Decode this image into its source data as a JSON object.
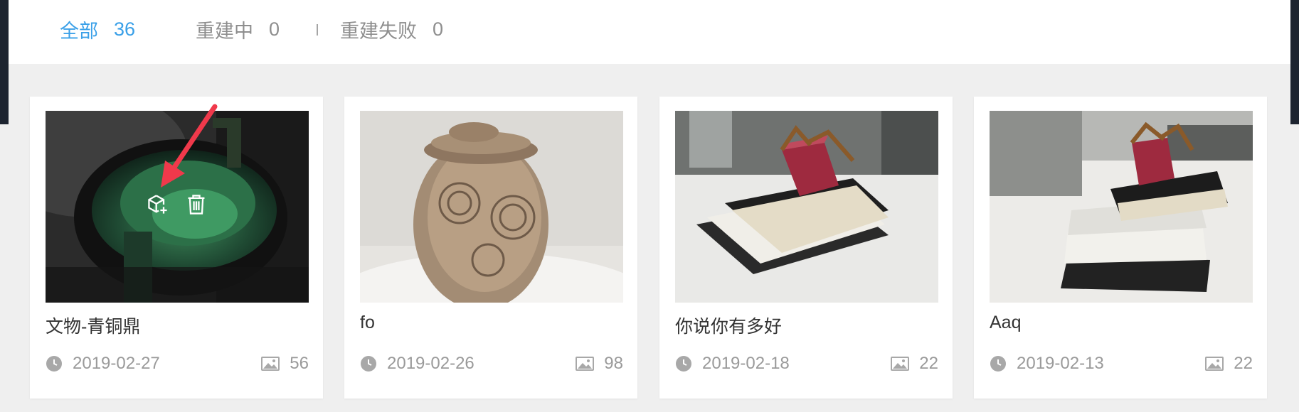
{
  "tabs": [
    {
      "label": "全部",
      "count": "36",
      "active": true
    },
    {
      "label": "重建中",
      "count": "0",
      "active": false
    },
    {
      "label": "重建失败",
      "count": "0",
      "active": false
    }
  ],
  "cards": [
    {
      "title": "文物-青铜鼎",
      "date": "2019-02-27",
      "photo_count": "56",
      "thumbnail": "bronze-ding"
    },
    {
      "title": "fo",
      "date": "2019-02-26",
      "photo_count": "98",
      "thumbnail": "carved-head"
    },
    {
      "title": "你说你有多好",
      "date": "2019-02-18",
      "photo_count": "22",
      "thumbnail": "gift-box-notebooks"
    },
    {
      "title": "Aaq",
      "date": "2019-02-13",
      "photo_count": "22",
      "thumbnail": "gift-box-notebooks-2"
    }
  ],
  "hover_actions": [
    "add-model-icon",
    "trash-icon"
  ],
  "icons": {
    "date": "clock-icon",
    "photos": "image-icon"
  },
  "colors": {
    "accent": "#3aa0e8",
    "muted": "#9a9a9a",
    "title": "#333333",
    "annotation": "#f0394b"
  }
}
